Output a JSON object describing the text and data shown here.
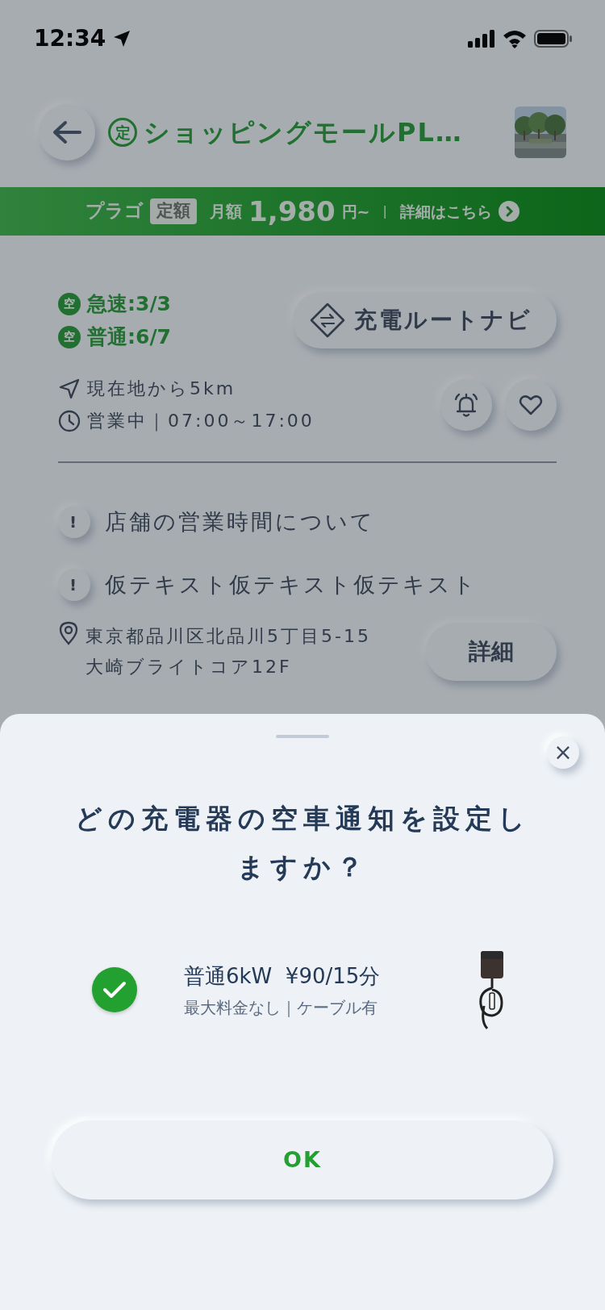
{
  "status_bar": {
    "time": "12:34"
  },
  "header": {
    "badge": "定",
    "title": "ショッピングモールPL…"
  },
  "plan_banner": {
    "brand": "プラゴ",
    "tag": "定額",
    "price_label": "月額",
    "price": "1,980",
    "unit": "円~",
    "separator": "|",
    "link": "詳細はこちら"
  },
  "availability": [
    {
      "badge": "空",
      "label": "急速:3/3"
    },
    {
      "badge": "空",
      "label": "普通:6/7"
    }
  ],
  "route_button": {
    "label": "充電ルートナビ"
  },
  "info": {
    "distance": "現在地から5km",
    "hours": "営業中｜07:00～17:00"
  },
  "notices": [
    {
      "mark": "!",
      "text": "店舗の営業時間について"
    },
    {
      "mark": "!",
      "text": "仮テキスト仮テキスト仮テキスト"
    }
  ],
  "address": {
    "lines": [
      "東京都品川区北品川5丁目5-15",
      "大崎ブライトコア12F"
    ]
  },
  "detail_button": {
    "label": "詳細"
  },
  "sheet": {
    "close": "×",
    "title": "どの充電器の空車通知を設定しますか？",
    "chargers": [
      {
        "name": "普通6kW  ¥90/15分",
        "details": "最大料金なし｜ケーブル有",
        "selected": true
      }
    ],
    "ok_button": {
      "label": "OK"
    }
  }
}
